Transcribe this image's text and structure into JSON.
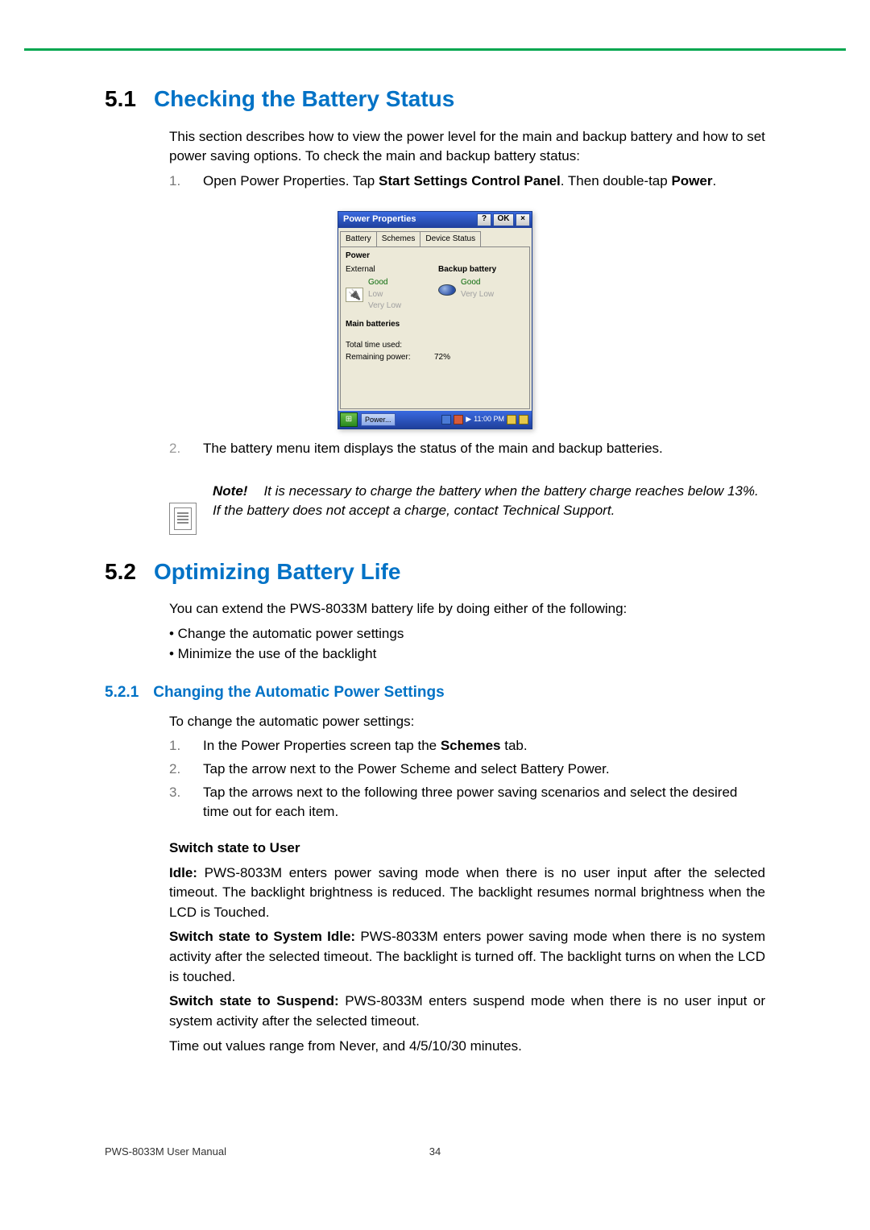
{
  "section51": {
    "num": "5.1",
    "title": "Checking the Battery Status",
    "intro": "This section describes how to view the power level for the main and backup battery and how to set power saving options. To check the main and backup battery status:",
    "step1_pre": "Open Power Properties. Tap ",
    "step1_b1": "Start",
    "step1_mid1": "  ",
    "step1_b2": "Settings",
    "step1_mid2": "  ",
    "step1_b3": "Control Panel",
    "step1_post": ". Then double-tap ",
    "step1_b4": "Power",
    "step1_end": ".",
    "step2": "The battery menu item displays the status of the main and backup batteries."
  },
  "pp": {
    "title": "Power Properties",
    "help": "?",
    "ok": "OK",
    "close": "×",
    "tab_battery": "Battery",
    "tab_schemes": "Schemes",
    "tab_device": "Device Status",
    "power_label": "Power",
    "external_label": "External",
    "backup_label": "Backup battery",
    "good": "Good",
    "low": "Low",
    "verylow": "Very Low",
    "main_label": "Main batteries",
    "total_time": "Total time used:",
    "remaining": "Remaining power:",
    "remaining_val": "72%",
    "taskbtn": "Power...",
    "clock": "11:00 PM"
  },
  "note": {
    "label": "Note!",
    "text": "It is necessary to charge the battery when the battery charge reaches below 13%. If the battery does not accept a charge, contact Technical Support."
  },
  "section52": {
    "num": "5.2",
    "title": "Optimizing Battery Life",
    "intro": "You can extend the PWS-8033M battery life by doing either of the following:",
    "bullet1": "• Change the automatic power settings",
    "bullet2": "• Minimize the use of the backlight"
  },
  "section521": {
    "num": "5.2.1",
    "title": "Changing the Automatic Power Settings",
    "intro": "To change the automatic power settings:",
    "s1_pre": "In the Power Properties screen tap the ",
    "s1_b": "Schemes",
    "s1_post": " tab.",
    "s2": "Tap the arrow next to the Power Scheme and select Battery Power.",
    "s3": "Tap the arrows next to the following three power saving scenarios and select the desired time out for each item.",
    "switch_head": "Switch state to User",
    "idle_b": "Idle:",
    "idle_text": " PWS-8033M enters power saving mode when there is no user input after the selected timeout. The backlight brightness is reduced. The backlight resumes normal brightness when the LCD is Touched.",
    "sys_b": "Switch state to System Idle:",
    "sys_text": " PWS-8033M enters power saving mode when there is no system activity after the selected timeout. The backlight is turned off. The backlight turns on when the LCD is touched.",
    "sus_b": "Switch state to Suspend:",
    "sus_text": " PWS-8033M enters suspend mode when there is no user input or system activity after the selected timeout.",
    "timeout": "Time out values range from Never, and 4/5/10/30 minutes."
  },
  "footer": {
    "left": "PWS-8033M User Manual",
    "page": "34"
  }
}
